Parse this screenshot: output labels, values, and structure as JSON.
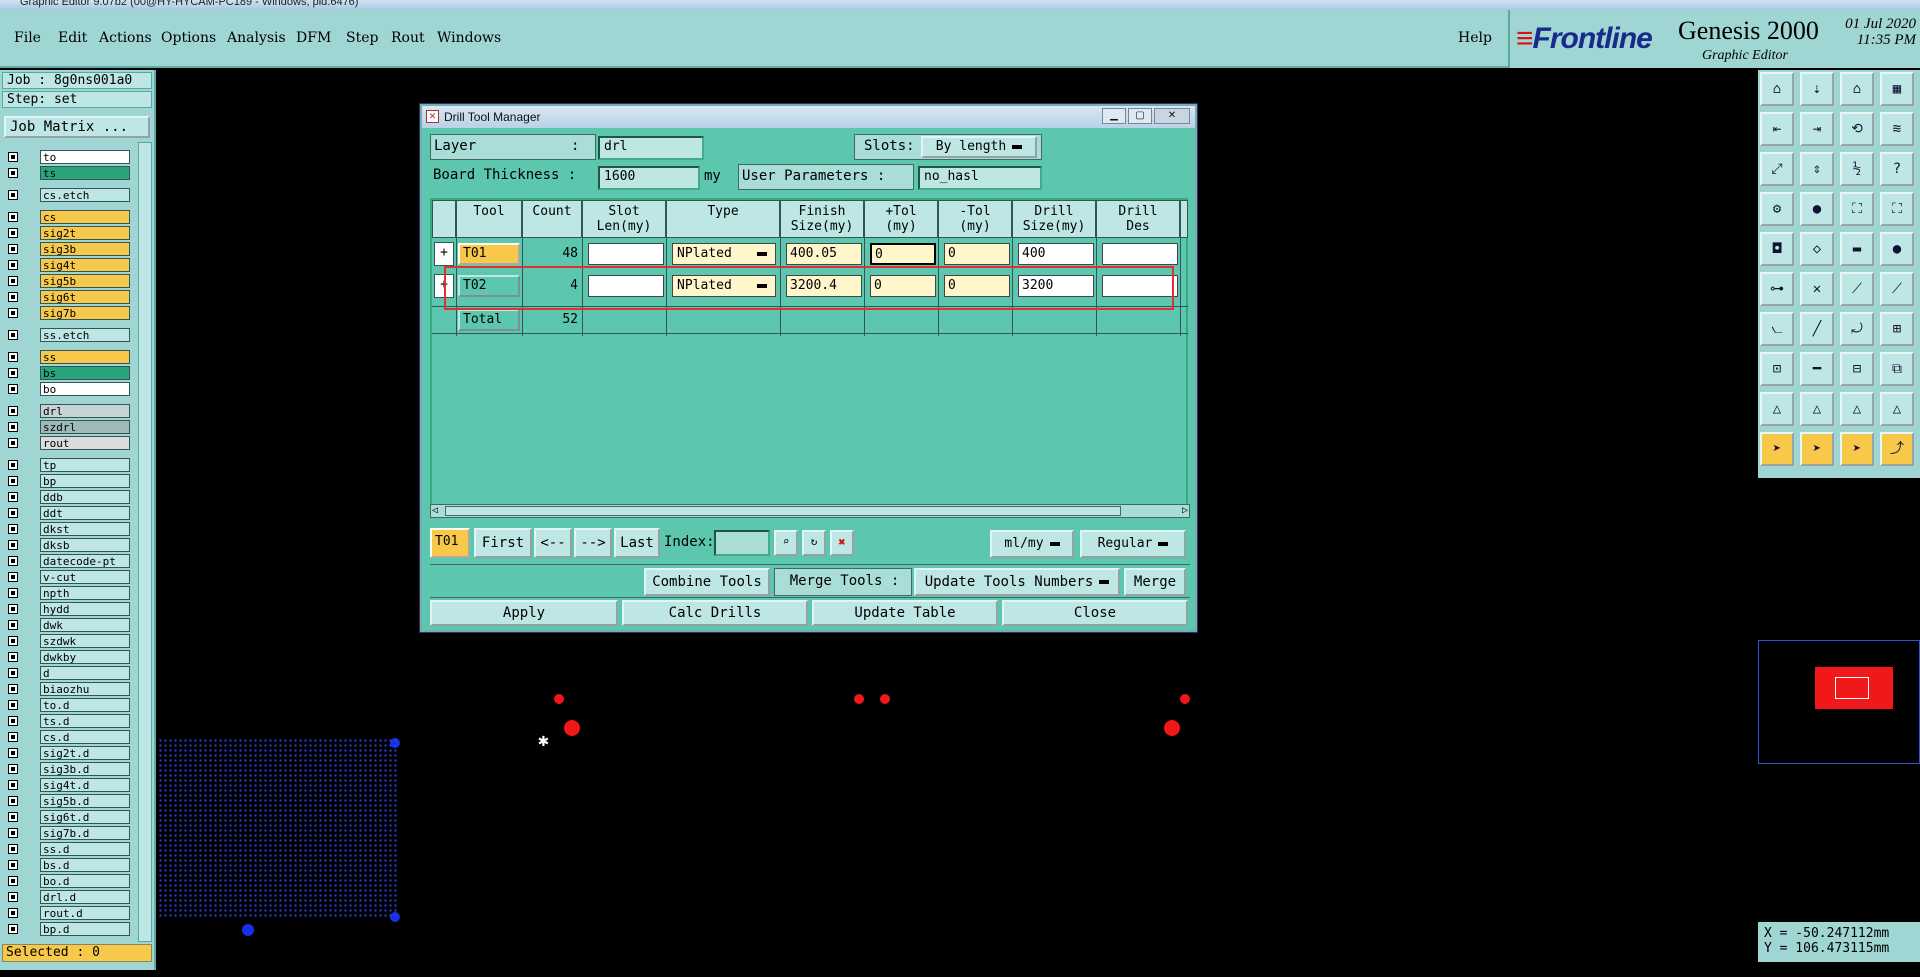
{
  "window": {
    "title": "Graphic Editor 9.07b2 (00@HY-HYCAM-PC189 - Windows, pid:6476)"
  },
  "menu": [
    "File",
    "Edit",
    "Actions",
    "Options",
    "Analysis",
    "DFM",
    "Step",
    "Rout",
    "Windows"
  ],
  "help": "Help",
  "brand": {
    "logo": "Frontline",
    "product": "Genesis 2000",
    "subtitle": "Graphic Editor",
    "date": "01 Jul 2020",
    "time": "11:35 PM"
  },
  "left": {
    "job": "Job : 8g0ns001a0",
    "step": "Step: set",
    "job_matrix": "Job Matrix ...",
    "layers": [
      {
        "name": "to",
        "color": "#ffffff"
      },
      {
        "name": "ts",
        "color": "#2aa57a"
      },
      {
        "name": "cs.etch",
        "color": "#bde6e4"
      },
      {
        "name": "cs",
        "color": "#f8c84a"
      },
      {
        "name": "sig2t",
        "color": "#f8c84a"
      },
      {
        "name": "sig3b",
        "color": "#f8c84a"
      },
      {
        "name": "sig4t",
        "color": "#f8c84a"
      },
      {
        "name": "sig5b",
        "color": "#f8c84a"
      },
      {
        "name": "sig6t",
        "color": "#f8c84a"
      },
      {
        "name": "sig7b",
        "color": "#f8c84a"
      },
      {
        "name": "ss.etch",
        "color": "#bde6e4"
      },
      {
        "name": "ss",
        "color": "#f8c84a"
      },
      {
        "name": "bs",
        "color": "#2aa57a"
      },
      {
        "name": "bo",
        "color": "#ffffff"
      },
      {
        "name": "drl",
        "color": "#c8d4d4"
      },
      {
        "name": "szdrl",
        "color": "#9fb8b8"
      },
      {
        "name": "rout",
        "color": "#dcdcdc"
      },
      {
        "name": "tp",
        "color": "#bde6e4"
      },
      {
        "name": "bp",
        "color": "#bde6e4"
      },
      {
        "name": "ddb",
        "color": "#bde6e4"
      },
      {
        "name": "ddt",
        "color": "#bde6e4"
      },
      {
        "name": "dkst",
        "color": "#bde6e4"
      },
      {
        "name": "dksb",
        "color": "#bde6e4"
      },
      {
        "name": "datecode-pt",
        "color": "#bde6e4"
      },
      {
        "name": "v-cut",
        "color": "#bde6e4"
      },
      {
        "name": "npth",
        "color": "#bde6e4"
      },
      {
        "name": "hydd",
        "color": "#bde6e4"
      },
      {
        "name": "dwk",
        "color": "#bde6e4"
      },
      {
        "name": "szdwk",
        "color": "#bde6e4"
      },
      {
        "name": "dwkby",
        "color": "#bde6e4"
      },
      {
        "name": "d",
        "color": "#bde6e4"
      },
      {
        "name": "biaozhu",
        "color": "#bde6e4"
      },
      {
        "name": "to.d",
        "color": "#bde6e4"
      },
      {
        "name": "ts.d",
        "color": "#bde6e4"
      },
      {
        "name": "cs.d",
        "color": "#bde6e4"
      },
      {
        "name": "sig2t.d",
        "color": "#bde6e4"
      },
      {
        "name": "sig3b.d",
        "color": "#bde6e4"
      },
      {
        "name": "sig4t.d",
        "color": "#bde6e4"
      },
      {
        "name": "sig5b.d",
        "color": "#bde6e4"
      },
      {
        "name": "sig6t.d",
        "color": "#bde6e4"
      },
      {
        "name": "sig7b.d",
        "color": "#bde6e4"
      },
      {
        "name": "ss.d",
        "color": "#bde6e4"
      },
      {
        "name": "bs.d",
        "color": "#bde6e4"
      },
      {
        "name": "bo.d",
        "color": "#bde6e4"
      },
      {
        "name": "drl.d",
        "color": "#bde6e4"
      },
      {
        "name": "rout.d",
        "color": "#bde6e4"
      },
      {
        "name": "bp.d",
        "color": "#bde6e4"
      }
    ],
    "selected": "Selected : 0"
  },
  "dialog": {
    "title": "Drill Tool Manager",
    "layer_label": "Layer",
    "layer_colon": ":",
    "layer_value": "drl",
    "slots_label": "Slots:",
    "slots_value": "By length",
    "thickness_label": "Board Thickness :",
    "thickness_value": "1600",
    "thickness_unit": "my",
    "user_params_label": "User Parameters :",
    "user_params_value": "no_hasl",
    "columns": [
      "Tool",
      "Count",
      "Slot\nLen(my)",
      "Type",
      "Finish\nSize(my)",
      "+Tol\n(my)",
      "-Tol\n(my)",
      "Drill\nSize(my)",
      "Drill\nDes"
    ],
    "rows": [
      {
        "tool": "T01",
        "count": "48",
        "slot_len": "",
        "type": "NPlated",
        "finish": "400.05",
        "ptol": "0",
        "mtol": "0",
        "drill": "400",
        "des": ""
      },
      {
        "tool": "T02",
        "count": "4",
        "slot_len": "",
        "type": "NPlated",
        "finish": "3200.4",
        "ptol": "0",
        "mtol": "0",
        "drill": "3200",
        "des": ""
      }
    ],
    "total_label": "Total",
    "total_count": "52",
    "current_tool": "T01",
    "nav": {
      "first": "First",
      "prev": "<--",
      "next": "-->",
      "last": "Last",
      "index_label": "Index:",
      "index_value": ""
    },
    "units_value": "ml/my",
    "mode_value": "Regular",
    "combine_tools": "Combine Tools",
    "merge_tools_label": "Merge Tools :",
    "merge_tools_value": "Update Tools Numbers",
    "merge": "Merge",
    "apply": "Apply",
    "calc_drills": "Calc Drills",
    "update_table": "Update Table",
    "close": "Close"
  },
  "coords": {
    "x": "X = -50.247112mm",
    "y": "Y = 106.473115mm"
  },
  "colors": {
    "panel": "#9fd6d4",
    "dialog": "#5cc7ae",
    "highlight": "#e03030",
    "tool_cell": "#f8c84a"
  }
}
